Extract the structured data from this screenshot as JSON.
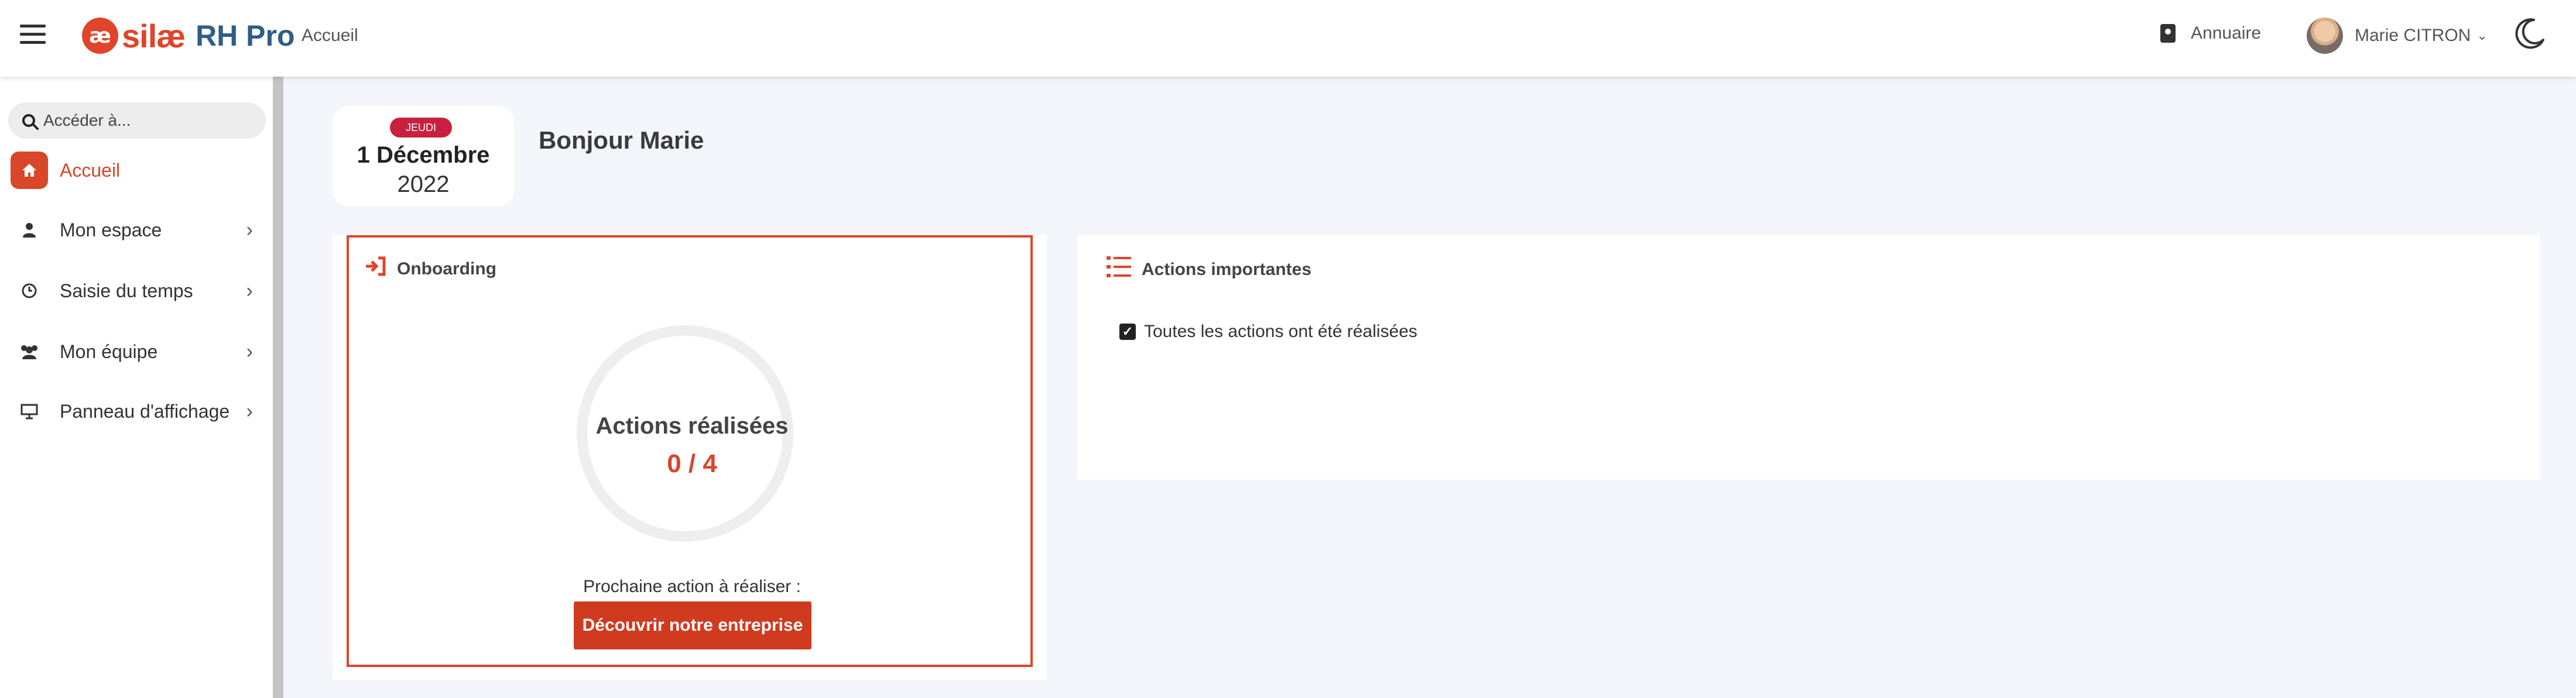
{
  "header": {
    "logo_symbol": "æ",
    "logo_text": "silæ",
    "logo_suffix": "RH Pro",
    "breadcrumb": "Accueil",
    "annuaire_label": "Annuaire",
    "user_name": "Marie CITRON",
    "accent_color": "#e0442a"
  },
  "sidebar": {
    "search_placeholder": "Accéder à...",
    "items": [
      {
        "label": "Accueil",
        "icon": "home-icon",
        "active": true
      },
      {
        "label": "Mon espace",
        "icon": "user-icon",
        "has_submenu": true
      },
      {
        "label": "Saisie du temps",
        "icon": "clock-icon",
        "has_submenu": true
      },
      {
        "label": "Mon équipe",
        "icon": "users-icon",
        "has_submenu": true
      },
      {
        "label": "Panneau d'affichage",
        "icon": "board-icon",
        "has_submenu": true
      }
    ]
  },
  "main": {
    "date": {
      "weekday": "JEUDI",
      "day_month": "1 Décembre",
      "year": "2022"
    },
    "greeting": "Bonjour Marie",
    "onboarding": {
      "title": "Onboarding",
      "progress_label": "Actions réalisées",
      "progress_value": "0 / 4",
      "next_label": "Prochaine action à réaliser :",
      "next_button": "Découvrir notre entreprise"
    },
    "actions": {
      "title": "Actions importantes",
      "items": [
        {
          "label": "Toutes les actions ont été réalisées",
          "checked": true
        }
      ]
    }
  }
}
